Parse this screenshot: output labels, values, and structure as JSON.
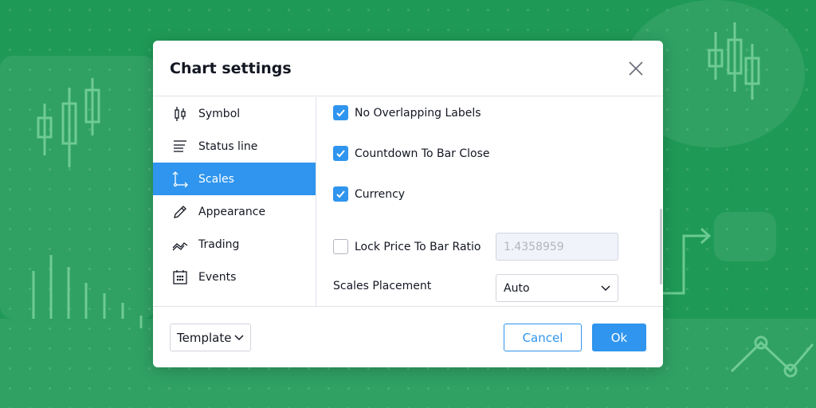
{
  "dialog": {
    "title": "Chart settings"
  },
  "sidebar": {
    "items": [
      {
        "label": "Symbol",
        "icon": "candlestick-icon"
      },
      {
        "label": "Status line",
        "icon": "status-line-icon"
      },
      {
        "label": "Scales",
        "icon": "scales-icon",
        "active": true
      },
      {
        "label": "Appearance",
        "icon": "pencil-icon"
      },
      {
        "label": "Trading",
        "icon": "trading-icon"
      },
      {
        "label": "Events",
        "icon": "calendar-icon"
      }
    ]
  },
  "scales": {
    "no_overlapping_labels": {
      "label": "No Overlapping Labels",
      "checked": true
    },
    "countdown": {
      "label": "Countdown To Bar Close",
      "checked": true
    },
    "currency": {
      "label": "Currency",
      "checked": true
    },
    "lock_ratio": {
      "label": "Lock Price To Bar Ratio",
      "checked": false,
      "value": "1.4358959"
    },
    "placement": {
      "label": "Scales Placement",
      "value": "Auto"
    }
  },
  "footer": {
    "template": "Template",
    "cancel": "Cancel",
    "ok": "Ok"
  },
  "colors": {
    "accent": "#2f95ee",
    "background": "#1f9a56"
  }
}
